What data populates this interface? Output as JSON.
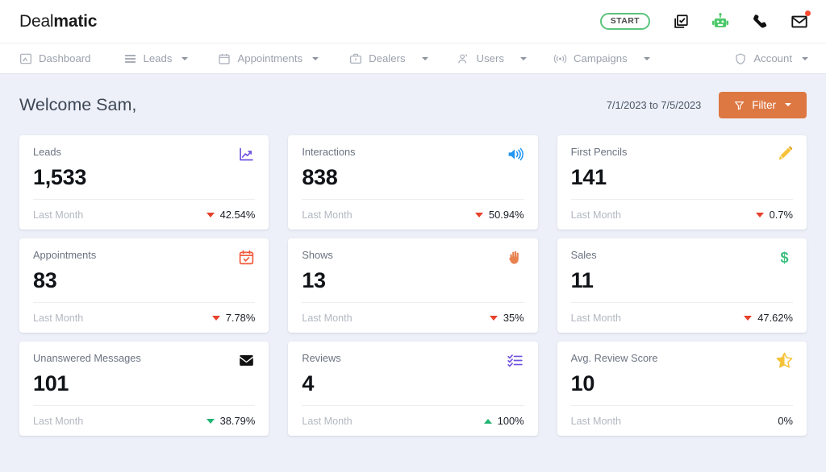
{
  "brand": {
    "light": "Deal",
    "bold": "matic"
  },
  "topbar": {
    "start_label": "START",
    "icons": [
      {
        "name": "checkbox-copy-icon",
        "label": "Tasks"
      },
      {
        "name": "robot-icon",
        "label": "Bot"
      },
      {
        "name": "phone-icon",
        "label": "Calls"
      },
      {
        "name": "envelope-icon",
        "label": "Messages",
        "has_badge": true
      }
    ]
  },
  "nav": {
    "items": [
      {
        "label": "Dashboard",
        "icon": "image-icon",
        "caret": false
      },
      {
        "label": "Leads",
        "icon": "list-lines-icon",
        "caret": true
      },
      {
        "label": "Appointments",
        "icon": "calendar-icon",
        "caret": true
      },
      {
        "label": "Dealers",
        "icon": "briefcase-icon",
        "caret": true
      },
      {
        "label": "Users",
        "icon": "users-icon",
        "caret": true
      },
      {
        "label": "Campaigns",
        "icon": "broadcast-icon",
        "caret": true
      }
    ],
    "account": {
      "label": "Account",
      "icon": "shield-icon",
      "caret": true
    }
  },
  "page": {
    "title": "Welcome Sam,",
    "date_range": "7/1/2023 to 7/5/2023",
    "filter_label": "Filter",
    "filter_color": "#dd7843"
  },
  "cards": [
    {
      "label": "Leads",
      "value": "1,533",
      "icon": "trend-chart-icon",
      "icon_color": "#6e51e0",
      "foot_label": "Last Month",
      "change": "42.54%",
      "direction": "down",
      "change_tone": "bad"
    },
    {
      "label": "Interactions",
      "value": "838",
      "icon": "speaker-icon",
      "icon_color": "#2196f3",
      "foot_label": "Last Month",
      "change": "50.94%",
      "direction": "down",
      "change_tone": "bad"
    },
    {
      "label": "First Pencils",
      "value": "141",
      "icon": "pencil-icon",
      "icon_color": "#f5c23a",
      "foot_label": "Last Month",
      "change": "0.7%",
      "direction": "down",
      "change_tone": "bad"
    },
    {
      "label": "Appointments",
      "value": "83",
      "icon": "calendar-check-icon",
      "icon_color": "#f05a3c",
      "foot_label": "Last Month",
      "change": "7.78%",
      "direction": "down",
      "change_tone": "bad"
    },
    {
      "label": "Shows",
      "value": "13",
      "icon": "raised-hand-icon",
      "icon_color": "#e8824f",
      "foot_label": "Last Month",
      "change": "35%",
      "direction": "down",
      "change_tone": "bad"
    },
    {
      "label": "Sales",
      "value": "11",
      "icon": "dollar-icon",
      "icon_color": "#3ec07f",
      "foot_label": "Last Month",
      "change": "47.62%",
      "direction": "down",
      "change_tone": "bad"
    },
    {
      "label": "Unanswered Messages",
      "value": "101",
      "icon": "envelope-icon",
      "icon_color": "#111111",
      "foot_label": "Last Month",
      "change": "38.79%",
      "direction": "down",
      "change_tone": "good"
    },
    {
      "label": "Reviews",
      "value": "4",
      "icon": "checklist-icon",
      "icon_color": "#6e51e0",
      "foot_label": "Last Month",
      "change": "100%",
      "direction": "up",
      "change_tone": "good"
    },
    {
      "label": "Avg. Review Score",
      "value": "10",
      "icon": "star-half-icon",
      "icon_color": "#f5c23a",
      "foot_label": "Last Month",
      "change": "0%",
      "direction": "none",
      "change_tone": "neutral"
    }
  ]
}
